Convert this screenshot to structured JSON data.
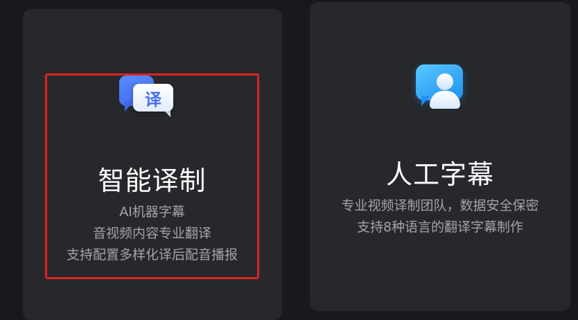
{
  "cards": [
    {
      "id": "ai-translation",
      "icon_name": "translate-chat-icon",
      "icon_glyph": "译",
      "title": "智能译制",
      "lines": [
        "AI机器字幕",
        "音视频内容专业翻译",
        "支持配置多样化译后配音播报"
      ],
      "selected": true
    },
    {
      "id": "human-subtitle",
      "icon_name": "person-chat-icon",
      "title": "人工字幕",
      "lines": [
        "专业视频译制团队，数据安全保密",
        "支持8种语言的翻译字幕制作"
      ],
      "selected": false
    }
  ],
  "colors": {
    "background": "#18191c",
    "card": "#27282c",
    "highlight_border": "#e0221b",
    "title": "#ffffff",
    "description": "#a3a4a8",
    "translate_icon_blue": "#4671ef",
    "person_icon_blue": "#1e8ff0"
  }
}
